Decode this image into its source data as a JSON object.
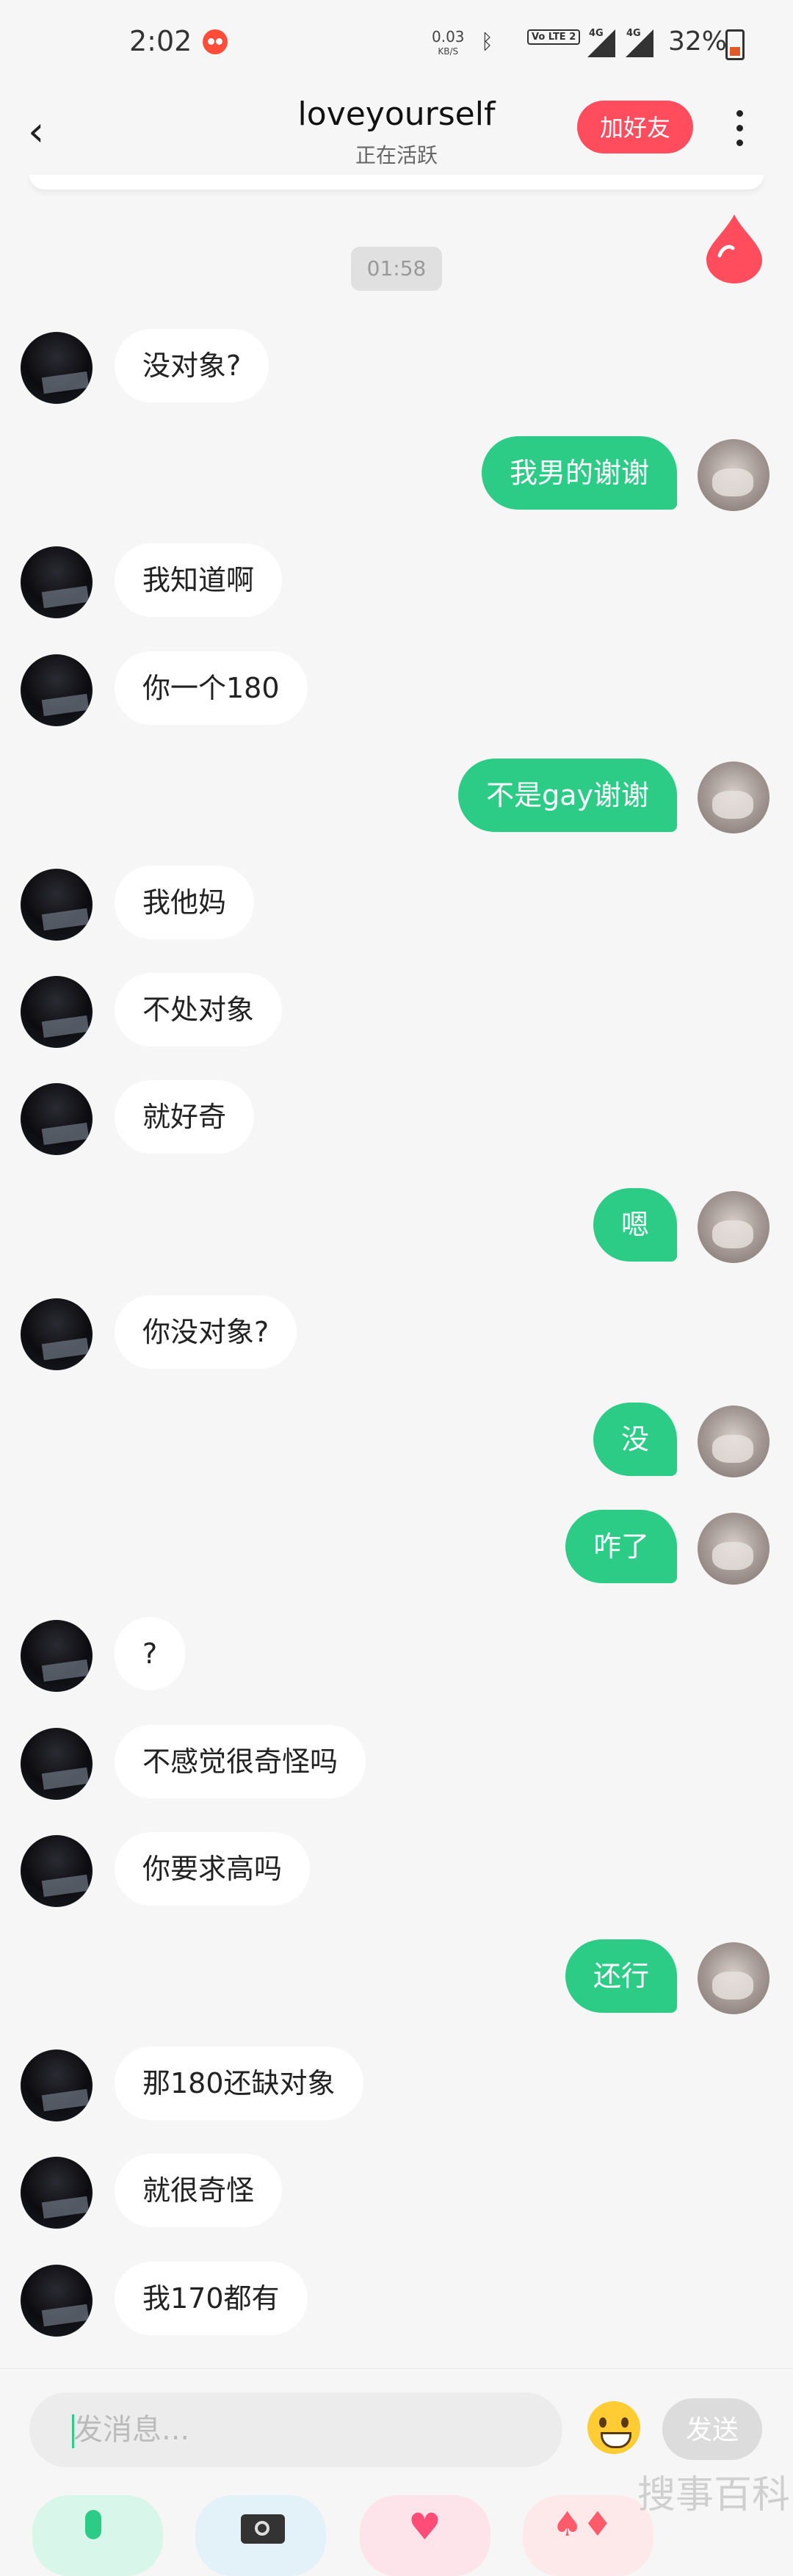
{
  "status_bar": {
    "time": "2:02",
    "net_speed": "0.03",
    "net_speed_unit": "KB/S",
    "volte": "Vo LTE 2",
    "signal1": "4G",
    "signal2": "4G",
    "battery": "32%"
  },
  "header": {
    "back_icon": "‹",
    "title": "loveyourself",
    "subtitle": "正在活跃",
    "add_friend": "加好友"
  },
  "timestamp": "01:58",
  "messages": [
    {
      "side": "left",
      "text": "没对象?"
    },
    {
      "side": "right",
      "text": "我男的谢谢"
    },
    {
      "side": "left",
      "text": "我知道啊"
    },
    {
      "side": "left",
      "text": "你一个180"
    },
    {
      "side": "right",
      "text": "不是gay谢谢"
    },
    {
      "side": "left",
      "text": "我他妈"
    },
    {
      "side": "left",
      "text": "不处对象"
    },
    {
      "side": "left",
      "text": "就好奇"
    },
    {
      "side": "right",
      "text": "嗯"
    },
    {
      "side": "left",
      "text": "你没对象?"
    },
    {
      "side": "right",
      "text": "没"
    },
    {
      "side": "right",
      "text": "咋了"
    },
    {
      "side": "left",
      "text": "?"
    },
    {
      "side": "left",
      "text": "不感觉很奇怪吗"
    },
    {
      "side": "left",
      "text": "你要求高吗"
    },
    {
      "side": "right",
      "text": "还行"
    },
    {
      "side": "left",
      "text": "那180还缺对象"
    },
    {
      "side": "left",
      "text": "就很奇怪"
    },
    {
      "side": "left",
      "text": "我170都有"
    }
  ],
  "input": {
    "placeholder": "发消息...",
    "send": "发送",
    "emoji_icon": "smile-emoji-icon"
  },
  "tools": [
    {
      "name": "voice",
      "icon": "microphone-icon"
    },
    {
      "name": "camera",
      "icon": "camera-icon"
    },
    {
      "name": "heart",
      "icon": "heart-icon"
    },
    {
      "name": "game",
      "icon": "game-icon"
    }
  ],
  "watermark": "搜事百科",
  "colors": {
    "accent_green": "#2dcc86",
    "add_friend_red": "#ff4d5e",
    "background": "#f6f6f6"
  }
}
